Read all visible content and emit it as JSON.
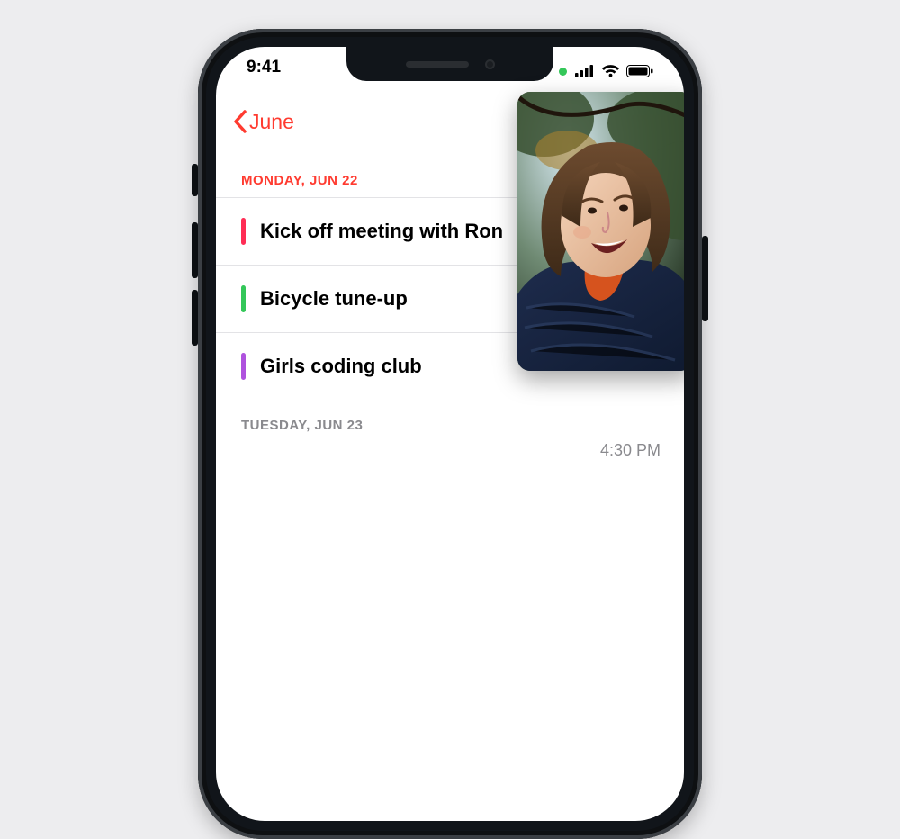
{
  "status": {
    "time": "9:41"
  },
  "nav": {
    "back_label": "June"
  },
  "sections": [
    {
      "header": "Monday, Jun 22",
      "today": true,
      "events": [
        {
          "title": "Kick off meeting with Ron",
          "color": "pink"
        },
        {
          "title": "Bicycle tune-up",
          "color": "green"
        },
        {
          "title": "Girls coding club",
          "color": "purple"
        }
      ]
    },
    {
      "header": "Tuesday, Jun 23",
      "today": false,
      "events": []
    }
  ],
  "time_hint": "4:30 PM"
}
